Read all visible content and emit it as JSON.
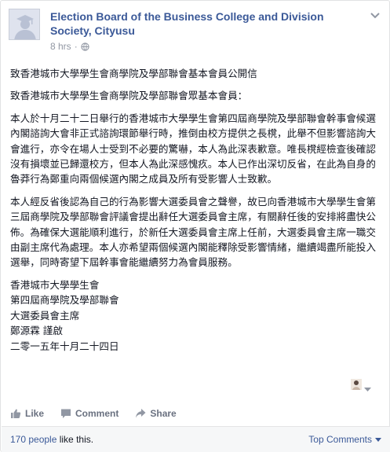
{
  "post": {
    "page_name": "Election Board of the Business College and Division Society, Cityusu",
    "timestamp": "8 hrs",
    "paragraphs": [
      "致香港城市大學學生會商學院及學部聯會基本會員公開信",
      "致香港城市大學學生會商學院及學部聯會眾基本會員：",
      "本人於十月二十二日舉行的香港城市大學學生會第四屆商學院及學部聯會幹事會候選內閣諮詢大會非正式諮詢環節舉行時，推倒由校方提供之長櫈，此舉不但影響諮詢大會進行，亦令在場人士受到不必要的驚嚇，本人為此深表歉意。唯長櫈經檢查後確認沒有損壞並已歸還校方，但本人為此深感愧疚。本人已作出深切反省，在此為自身的魯莽行為鄭重向兩個候選內閣之成員及所有受影響人士致歉。",
      "本人經反省後認為自己的行為影響大選委員會之聲譽，故已向香港城市大學學生會第三屆商學院及學部聯會評議會提出辭任大選委員會主席，有關辭任後的安排將盡快公佈。為確保大選能順利進行，於新任大選委員會主席上任前，大選委員會主席一職交由副主席代為處理。本人亦希望兩個候選內閣能釋除受影響情緒，繼續竭盡所能投入選舉，同時寄望下屆幹事會能繼續努力為會員服務。"
    ],
    "signature": [
      "香港城市大學學生會",
      "第四屆商學院及學部聯會",
      "大選委員會主席",
      "鄭源霖 謹啟",
      "二零一五年十月二十四日"
    ]
  },
  "actions": {
    "like": "Like",
    "comment": "Comment",
    "share": "Share"
  },
  "footer": {
    "likes_link": "170 people",
    "likes_suffix": " like this.",
    "top_comments": "Top Comments"
  },
  "icons": {
    "avatar": "graduate-silhouette-icon",
    "globe": "globe-icon",
    "like": "thumbs-up-icon",
    "comment": "speech-bubble-icon",
    "share": "share-arrow-icon",
    "menu": "chevron-down-icon"
  },
  "colors": {
    "link": "#3b5998",
    "meta": "#9197a3",
    "action": "#6a7180"
  }
}
